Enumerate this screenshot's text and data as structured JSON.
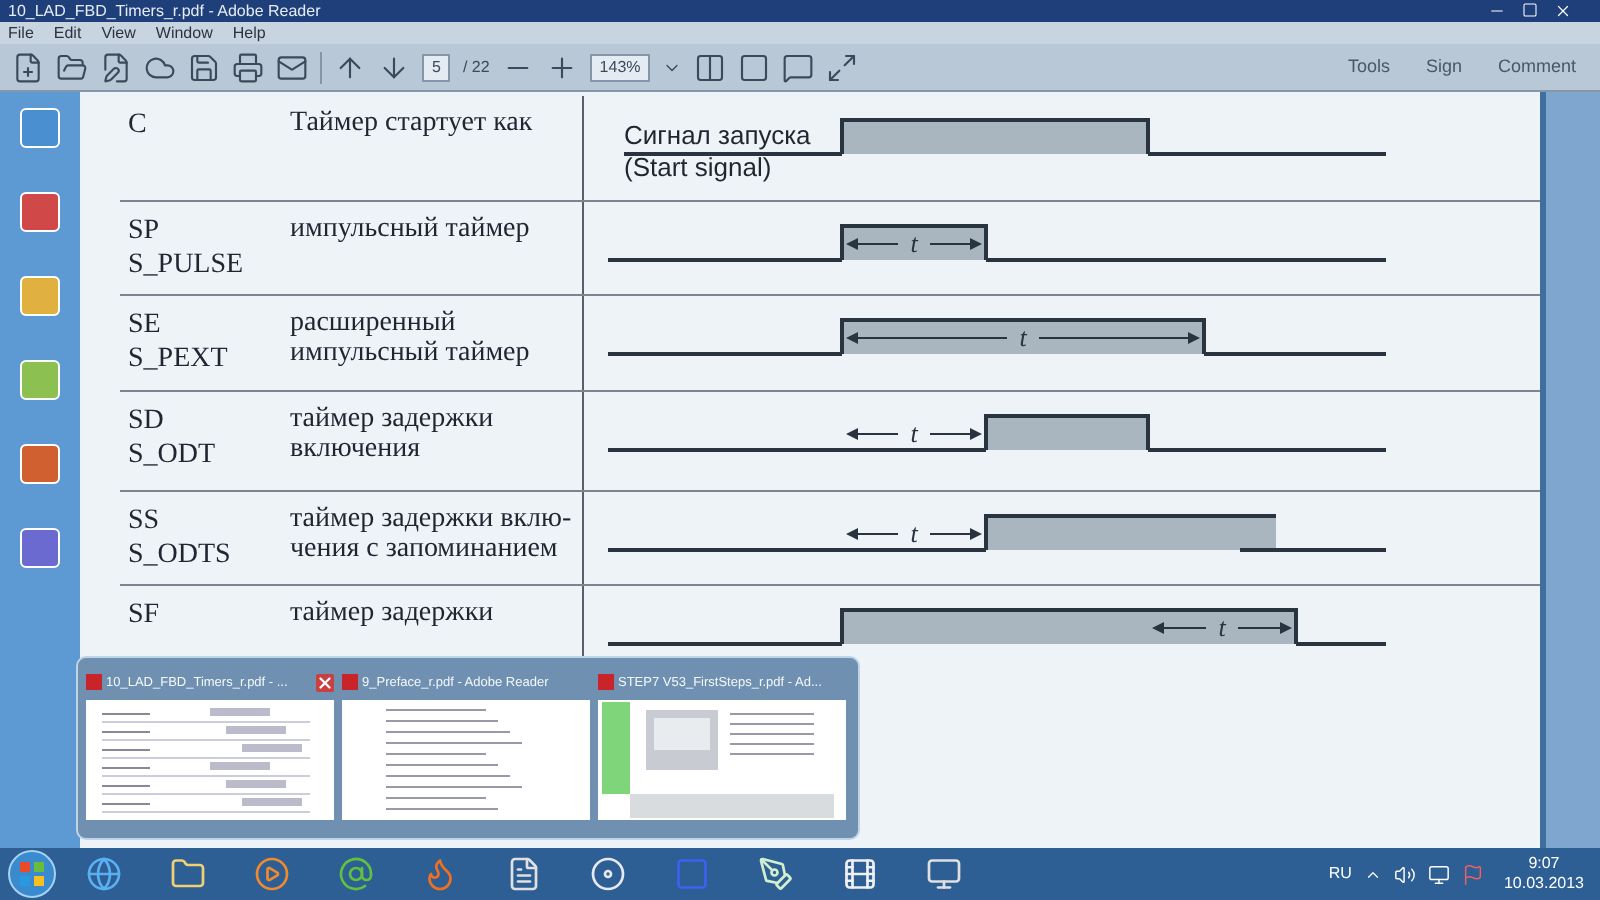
{
  "window": {
    "title": "10_LAD_FBD_Timers_r.pdf - Adobe Reader"
  },
  "menu": [
    "File",
    "Edit",
    "View",
    "Window",
    "Help"
  ],
  "toolbar": {
    "page": "5",
    "page_total": "/ 22",
    "zoom": "143%",
    "panels": [
      "Tools",
      "Sign",
      "Comment"
    ]
  },
  "timers": [
    {
      "kind": "start",
      "codes": [
        "C"
      ],
      "description": [
        "Таймер стартует как"
      ],
      "signal_label": [
        "Сигнал запуска",
        "(Start signal)"
      ]
    },
    {
      "kind": "pulse",
      "codes": [
        "SP",
        "S_PULSE"
      ],
      "description": [
        "импульсный таймер"
      ],
      "duration_label": "t"
    },
    {
      "kind": "extended",
      "codes": [
        "SE",
        "S_PEXT"
      ],
      "description": [
        "расширенный",
        "импульсный таймер"
      ],
      "duration_label": "t"
    },
    {
      "kind": "on_delay",
      "codes": [
        "SD",
        "S_ODT"
      ],
      "description": [
        "таймер задержки",
        "включения"
      ],
      "duration_label": "t"
    },
    {
      "kind": "retentive",
      "codes": [
        "SS",
        "S_ODTS"
      ],
      "description": [
        "таймер задержки вклю-",
        "чения с запоминанием"
      ],
      "duration_label": "t"
    },
    {
      "kind": "off_delay",
      "codes": [
        "SF"
      ],
      "description": [
        "таймер задержки"
      ],
      "duration_label": "t"
    }
  ],
  "previews": [
    {
      "kind": "timers",
      "title": "10_LAD_FBD_Timers_r.pdf - ...",
      "closable": true
    },
    {
      "kind": "contents",
      "title": "9_Preface_r.pdf - Adobe Reader",
      "closable": false
    },
    {
      "kind": "guide",
      "title": "STEP7 V53_FirstSteps_r.pdf - Ad...",
      "closable": false
    }
  ],
  "tray": {
    "language": "RU",
    "time": "9:07",
    "date": "10.03.2013"
  }
}
